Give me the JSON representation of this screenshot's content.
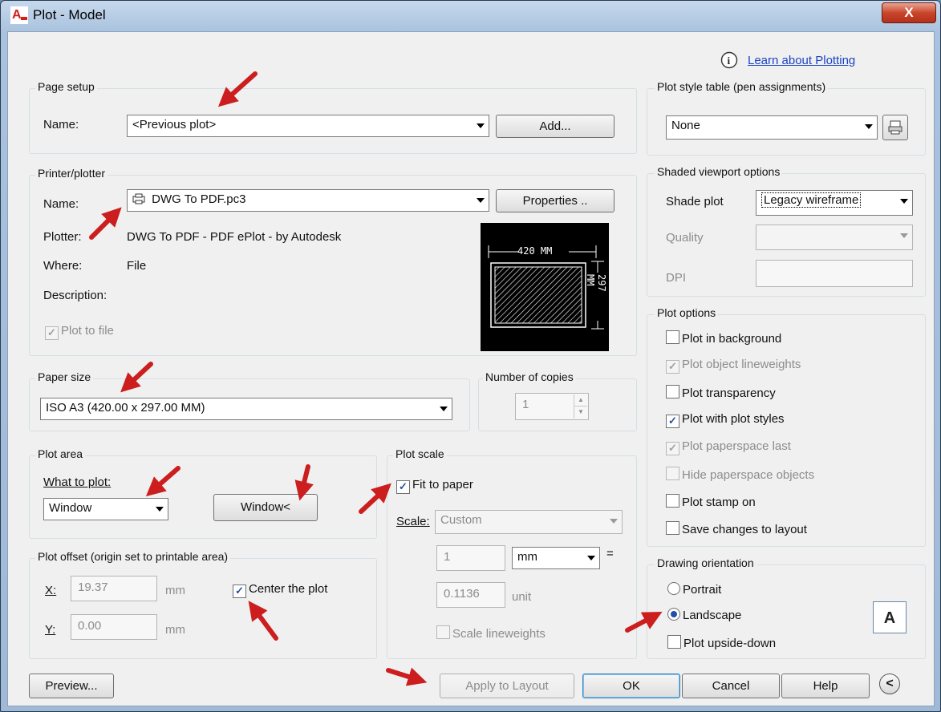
{
  "window": {
    "title": "Plot - Model",
    "close": "X"
  },
  "help_link": {
    "text": "Learn about Plotting"
  },
  "page_setup": {
    "legend": "Page setup",
    "name_label": "Name:",
    "name_value": "<Previous plot>",
    "add_button": "Add..."
  },
  "printer": {
    "legend": "Printer/plotter",
    "name_label": "Name:",
    "name_value": "DWG To PDF.pc3",
    "properties_button": "Properties ..",
    "plotter_label": "Plotter:",
    "plotter_value": "DWG To PDF - PDF ePlot - by Autodesk",
    "where_label": "Where:",
    "where_value": "File",
    "description_label": "Description:",
    "plot_to_file": "Plot to file",
    "preview_width": "420 MM",
    "preview_height": "297 MM"
  },
  "paper_size": {
    "legend": "Paper size",
    "value": "ISO A3 (420.00 x 297.00 MM)"
  },
  "copies": {
    "legend": "Number of copies",
    "value": "1"
  },
  "plot_area": {
    "legend": "Plot area",
    "what_label": "What to plot:",
    "what_value": "Window",
    "window_button": "Window<"
  },
  "plot_offset": {
    "legend": "Plot offset (origin set to printable area)",
    "x_label": "X:",
    "x_value": "19.37",
    "x_unit": "mm",
    "y_label": "Y:",
    "y_value": "0.00",
    "y_unit": "mm",
    "center": "Center the plot"
  },
  "plot_scale": {
    "legend": "Plot scale",
    "fit": "Fit to paper",
    "scale_label": "Scale:",
    "scale_value": "Custom",
    "value1": "1",
    "unit1": "mm",
    "equals": "=",
    "value2": "0.1136",
    "unit2": "unit",
    "lineweights": "Scale lineweights"
  },
  "style_table": {
    "legend": "Plot style table (pen assignments)",
    "value": "None"
  },
  "shaded": {
    "legend": "Shaded viewport options",
    "shade_label": "Shade plot",
    "shade_value": "Legacy wireframe",
    "quality_label": "Quality",
    "dpi_label": "DPI"
  },
  "plot_options": {
    "legend": "Plot options",
    "items": [
      {
        "label": "Plot in background",
        "checked": false,
        "disabled": false
      },
      {
        "label": "Plot object lineweights",
        "checked": true,
        "disabled": true
      },
      {
        "label": "Plot transparency",
        "checked": false,
        "disabled": false
      },
      {
        "label": "Plot with plot styles",
        "checked": true,
        "disabled": false
      },
      {
        "label": "Plot paperspace last",
        "checked": true,
        "disabled": true
      },
      {
        "label": "Hide paperspace objects",
        "checked": false,
        "disabled": true
      },
      {
        "label": "Plot stamp on",
        "checked": false,
        "disabled": false
      },
      {
        "label": "Save changes to layout",
        "checked": false,
        "disabled": false
      }
    ]
  },
  "orientation": {
    "legend": "Drawing orientation",
    "portrait": "Portrait",
    "landscape": "Landscape",
    "upside": "Plot upside-down",
    "icon_letter": "A"
  },
  "footer": {
    "preview": "Preview...",
    "apply": "Apply to Layout",
    "ok": "OK",
    "cancel": "Cancel",
    "help": "Help",
    "collapse": "<"
  }
}
